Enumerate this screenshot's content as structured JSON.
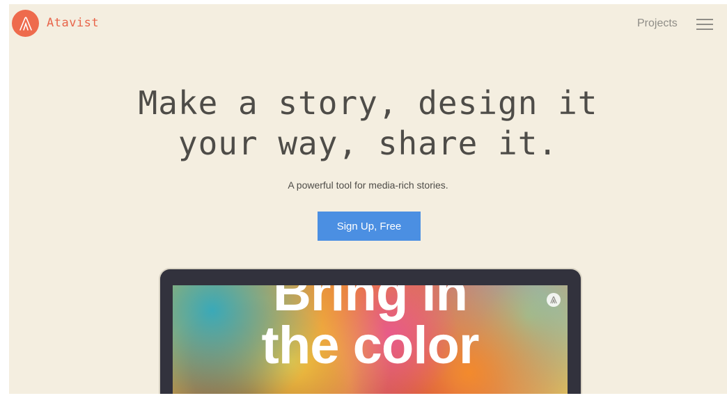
{
  "header": {
    "brand_name": "Atavist",
    "logo_icon": "atavist-logo-icon",
    "nav_links": [
      "Projects"
    ],
    "menu_icon": "hamburger-menu-icon"
  },
  "hero": {
    "title_line1": "Make a story, design it",
    "title_line2": "your way, share it.",
    "subtitle": "A powerful tool for media-rich stories.",
    "cta_label": "Sign Up, Free"
  },
  "preview": {
    "headline_line1": "Bring in",
    "headline_line2": "the color",
    "badge_icon": "atavist-badge-icon"
  },
  "colors": {
    "background": "#f4eee0",
    "accent": "#ee6b4d",
    "cta": "#4b8fe2",
    "text": "#4e4c48",
    "muted": "#8f8d87",
    "device_frame": "#32323d"
  }
}
